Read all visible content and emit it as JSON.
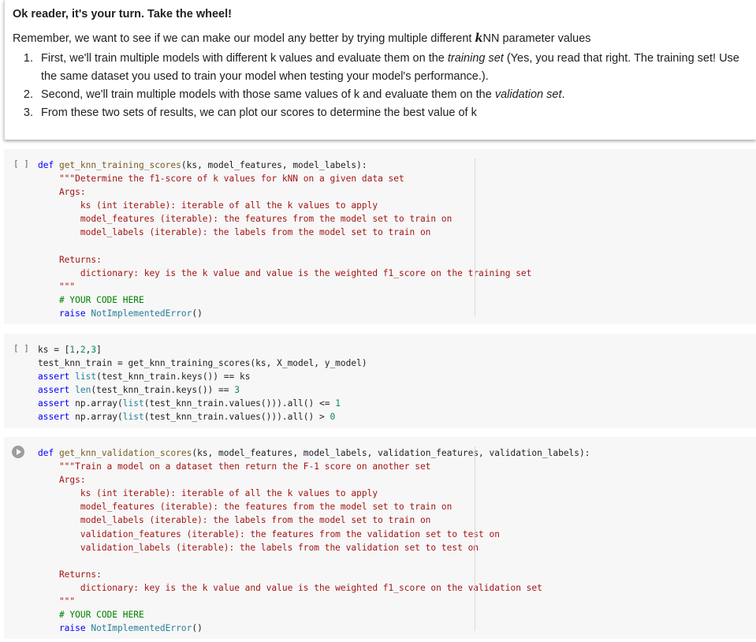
{
  "text_cell": {
    "heading": "Ok reader, it's your turn. Take the wheel!",
    "intro_before": "Remember, we want to see if we can make our model any better by trying multiple different ",
    "intro_k": "k",
    "intro_after": "NN parameter values",
    "steps": [
      {
        "before": "First, we'll train multiple models with different k values and evaluate them on the ",
        "em": "training set",
        "after": " (Yes, you read that right. The training set! Use the same dataset you used to train your model when testing your model's performance.)."
      },
      {
        "before": "Second, we'll train multiple models with those same values of k and evaluate them on the ",
        "em": "validation set",
        "after": "."
      },
      {
        "before": "From these two sets of results, we can plot our scores to determine the best value of k",
        "em": "",
        "after": ""
      }
    ]
  },
  "cells": [
    {
      "run_label": "[ ]",
      "lines": [
        [
          [
            "kw",
            "def "
          ],
          [
            "fn",
            "get_knn_training_scores"
          ],
          [
            "",
            "(ks, model_features, model_labels):"
          ]
        ],
        [
          [
            "str",
            "    \"\"\"Determine the f1-score of k values for kNN on a given data set"
          ]
        ],
        [
          [
            "str",
            "    Args:"
          ]
        ],
        [
          [
            "str",
            "        ks (int iterable): iterable of all the k values to apply"
          ]
        ],
        [
          [
            "str",
            "        model_features (iterable): the features from the model set to train on"
          ]
        ],
        [
          [
            "str",
            "        model_labels (iterable): the labels from the model set to train on"
          ]
        ],
        [
          [
            "str",
            ""
          ]
        ],
        [
          [
            "str",
            "    Returns:"
          ]
        ],
        [
          [
            "str",
            "        dictionary: key is the k value and value is the weighted f1_score on the training set"
          ]
        ],
        [
          [
            "str",
            "    \"\"\""
          ]
        ],
        [
          [
            "cm",
            "    # YOUR CODE HERE"
          ]
        ],
        [
          [
            "kw",
            "    raise "
          ],
          [
            "bi",
            "NotImplementedError"
          ],
          [
            "",
            "()"
          ]
        ]
      ]
    },
    {
      "run_label": "[ ]",
      "lines": [
        [
          [
            "",
            "ks = ["
          ],
          [
            "num",
            "1"
          ],
          [
            "",
            ","
          ],
          [
            "num",
            "2"
          ],
          [
            "",
            ","
          ],
          [
            "num",
            "3"
          ],
          [
            "",
            "]"
          ]
        ],
        [
          [
            "",
            "test_knn_train = get_knn_training_scores(ks, X_model, y_model)"
          ]
        ],
        [
          [
            "kw",
            "assert "
          ],
          [
            "bi",
            "list"
          ],
          [
            "",
            "(test_knn_train.keys()) == ks"
          ]
        ],
        [
          [
            "kw",
            "assert "
          ],
          [
            "bi",
            "len"
          ],
          [
            "",
            "(test_knn_train.keys()) == "
          ],
          [
            "num",
            "3"
          ]
        ],
        [
          [
            "kw",
            "assert "
          ],
          [
            "",
            "np.array("
          ],
          [
            "bi",
            "list"
          ],
          [
            "",
            "(test_knn_train.values())).all() <= "
          ],
          [
            "num",
            "1"
          ]
        ],
        [
          [
            "kw",
            "assert "
          ],
          [
            "",
            "np.array("
          ],
          [
            "bi",
            "list"
          ],
          [
            "",
            "(test_knn_train.values())).all() > "
          ],
          [
            "num",
            "0"
          ]
        ]
      ]
    },
    {
      "run_label": "",
      "lines": [
        [
          [
            "kw",
            "def "
          ],
          [
            "fn",
            "get_knn_validation_scores"
          ],
          [
            "",
            "(ks, model_features, model_labels, validation_features, validation_labels):"
          ]
        ],
        [
          [
            "str",
            "    \"\"\"Train a model on a dataset then return the F-1 score on another set"
          ]
        ],
        [
          [
            "str",
            "    Args:"
          ]
        ],
        [
          [
            "str",
            "        ks (int iterable): iterable of all the k values to apply"
          ]
        ],
        [
          [
            "str",
            "        model_features (iterable): the features from the model set to train on"
          ]
        ],
        [
          [
            "str",
            "        model_labels (iterable): the labels from the model set to train on"
          ]
        ],
        [
          [
            "str",
            "        validation_features (iterable): the features from the validation set to test on"
          ]
        ],
        [
          [
            "str",
            "        validation_labels (iterable): the labels from the validation set to test on"
          ]
        ],
        [
          [
            "str",
            ""
          ]
        ],
        [
          [
            "str",
            "    Returns:"
          ]
        ],
        [
          [
            "str",
            "        dictionary: key is the k value and value is the weighted f1_score on the validation set"
          ]
        ],
        [
          [
            "str",
            "    \"\"\""
          ]
        ],
        [
          [
            "cm",
            "    # YOUR CODE HERE"
          ]
        ],
        [
          [
            "kw",
            "    raise "
          ],
          [
            "bi",
            "NotImplementedError"
          ],
          [
            "",
            "()"
          ]
        ]
      ]
    }
  ]
}
